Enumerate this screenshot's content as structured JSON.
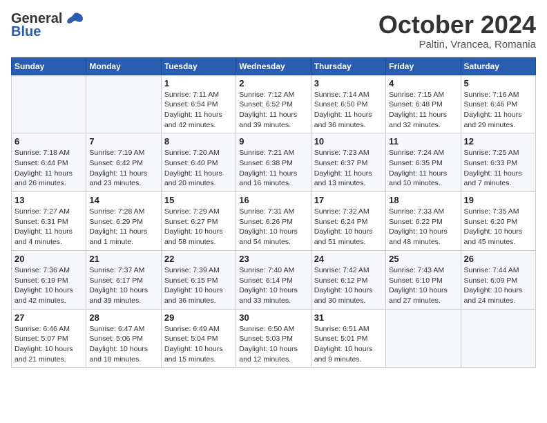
{
  "header": {
    "logo_general": "General",
    "logo_blue": "Blue",
    "month": "October 2024",
    "location": "Paltin, Vrancea, Romania"
  },
  "weekdays": [
    "Sunday",
    "Monday",
    "Tuesday",
    "Wednesday",
    "Thursday",
    "Friday",
    "Saturday"
  ],
  "weeks": [
    [
      {
        "day": "",
        "sunrise": "",
        "sunset": "",
        "daylight": ""
      },
      {
        "day": "",
        "sunrise": "",
        "sunset": "",
        "daylight": ""
      },
      {
        "day": "1",
        "sunrise": "Sunrise: 7:11 AM",
        "sunset": "Sunset: 6:54 PM",
        "daylight": "Daylight: 11 hours and 42 minutes."
      },
      {
        "day": "2",
        "sunrise": "Sunrise: 7:12 AM",
        "sunset": "Sunset: 6:52 PM",
        "daylight": "Daylight: 11 hours and 39 minutes."
      },
      {
        "day": "3",
        "sunrise": "Sunrise: 7:14 AM",
        "sunset": "Sunset: 6:50 PM",
        "daylight": "Daylight: 11 hours and 36 minutes."
      },
      {
        "day": "4",
        "sunrise": "Sunrise: 7:15 AM",
        "sunset": "Sunset: 6:48 PM",
        "daylight": "Daylight: 11 hours and 32 minutes."
      },
      {
        "day": "5",
        "sunrise": "Sunrise: 7:16 AM",
        "sunset": "Sunset: 6:46 PM",
        "daylight": "Daylight: 11 hours and 29 minutes."
      }
    ],
    [
      {
        "day": "6",
        "sunrise": "Sunrise: 7:18 AM",
        "sunset": "Sunset: 6:44 PM",
        "daylight": "Daylight: 11 hours and 26 minutes."
      },
      {
        "day": "7",
        "sunrise": "Sunrise: 7:19 AM",
        "sunset": "Sunset: 6:42 PM",
        "daylight": "Daylight: 11 hours and 23 minutes."
      },
      {
        "day": "8",
        "sunrise": "Sunrise: 7:20 AM",
        "sunset": "Sunset: 6:40 PM",
        "daylight": "Daylight: 11 hours and 20 minutes."
      },
      {
        "day": "9",
        "sunrise": "Sunrise: 7:21 AM",
        "sunset": "Sunset: 6:38 PM",
        "daylight": "Daylight: 11 hours and 16 minutes."
      },
      {
        "day": "10",
        "sunrise": "Sunrise: 7:23 AM",
        "sunset": "Sunset: 6:37 PM",
        "daylight": "Daylight: 11 hours and 13 minutes."
      },
      {
        "day": "11",
        "sunrise": "Sunrise: 7:24 AM",
        "sunset": "Sunset: 6:35 PM",
        "daylight": "Daylight: 11 hours and 10 minutes."
      },
      {
        "day": "12",
        "sunrise": "Sunrise: 7:25 AM",
        "sunset": "Sunset: 6:33 PM",
        "daylight": "Daylight: 11 hours and 7 minutes."
      }
    ],
    [
      {
        "day": "13",
        "sunrise": "Sunrise: 7:27 AM",
        "sunset": "Sunset: 6:31 PM",
        "daylight": "Daylight: 11 hours and 4 minutes."
      },
      {
        "day": "14",
        "sunrise": "Sunrise: 7:28 AM",
        "sunset": "Sunset: 6:29 PM",
        "daylight": "Daylight: 11 hours and 1 minute."
      },
      {
        "day": "15",
        "sunrise": "Sunrise: 7:29 AM",
        "sunset": "Sunset: 6:27 PM",
        "daylight": "Daylight: 10 hours and 58 minutes."
      },
      {
        "day": "16",
        "sunrise": "Sunrise: 7:31 AM",
        "sunset": "Sunset: 6:26 PM",
        "daylight": "Daylight: 10 hours and 54 minutes."
      },
      {
        "day": "17",
        "sunrise": "Sunrise: 7:32 AM",
        "sunset": "Sunset: 6:24 PM",
        "daylight": "Daylight: 10 hours and 51 minutes."
      },
      {
        "day": "18",
        "sunrise": "Sunrise: 7:33 AM",
        "sunset": "Sunset: 6:22 PM",
        "daylight": "Daylight: 10 hours and 48 minutes."
      },
      {
        "day": "19",
        "sunrise": "Sunrise: 7:35 AM",
        "sunset": "Sunset: 6:20 PM",
        "daylight": "Daylight: 10 hours and 45 minutes."
      }
    ],
    [
      {
        "day": "20",
        "sunrise": "Sunrise: 7:36 AM",
        "sunset": "Sunset: 6:19 PM",
        "daylight": "Daylight: 10 hours and 42 minutes."
      },
      {
        "day": "21",
        "sunrise": "Sunrise: 7:37 AM",
        "sunset": "Sunset: 6:17 PM",
        "daylight": "Daylight: 10 hours and 39 minutes."
      },
      {
        "day": "22",
        "sunrise": "Sunrise: 7:39 AM",
        "sunset": "Sunset: 6:15 PM",
        "daylight": "Daylight: 10 hours and 36 minutes."
      },
      {
        "day": "23",
        "sunrise": "Sunrise: 7:40 AM",
        "sunset": "Sunset: 6:14 PM",
        "daylight": "Daylight: 10 hours and 33 minutes."
      },
      {
        "day": "24",
        "sunrise": "Sunrise: 7:42 AM",
        "sunset": "Sunset: 6:12 PM",
        "daylight": "Daylight: 10 hours and 30 minutes."
      },
      {
        "day": "25",
        "sunrise": "Sunrise: 7:43 AM",
        "sunset": "Sunset: 6:10 PM",
        "daylight": "Daylight: 10 hours and 27 minutes."
      },
      {
        "day": "26",
        "sunrise": "Sunrise: 7:44 AM",
        "sunset": "Sunset: 6:09 PM",
        "daylight": "Daylight: 10 hours and 24 minutes."
      }
    ],
    [
      {
        "day": "27",
        "sunrise": "Sunrise: 6:46 AM",
        "sunset": "Sunset: 5:07 PM",
        "daylight": "Daylight: 10 hours and 21 minutes."
      },
      {
        "day": "28",
        "sunrise": "Sunrise: 6:47 AM",
        "sunset": "Sunset: 5:06 PM",
        "daylight": "Daylight: 10 hours and 18 minutes."
      },
      {
        "day": "29",
        "sunrise": "Sunrise: 6:49 AM",
        "sunset": "Sunset: 5:04 PM",
        "daylight": "Daylight: 10 hours and 15 minutes."
      },
      {
        "day": "30",
        "sunrise": "Sunrise: 6:50 AM",
        "sunset": "Sunset: 5:03 PM",
        "daylight": "Daylight: 10 hours and 12 minutes."
      },
      {
        "day": "31",
        "sunrise": "Sunrise: 6:51 AM",
        "sunset": "Sunset: 5:01 PM",
        "daylight": "Daylight: 10 hours and 9 minutes."
      },
      {
        "day": "",
        "sunrise": "",
        "sunset": "",
        "daylight": ""
      },
      {
        "day": "",
        "sunrise": "",
        "sunset": "",
        "daylight": ""
      }
    ]
  ]
}
